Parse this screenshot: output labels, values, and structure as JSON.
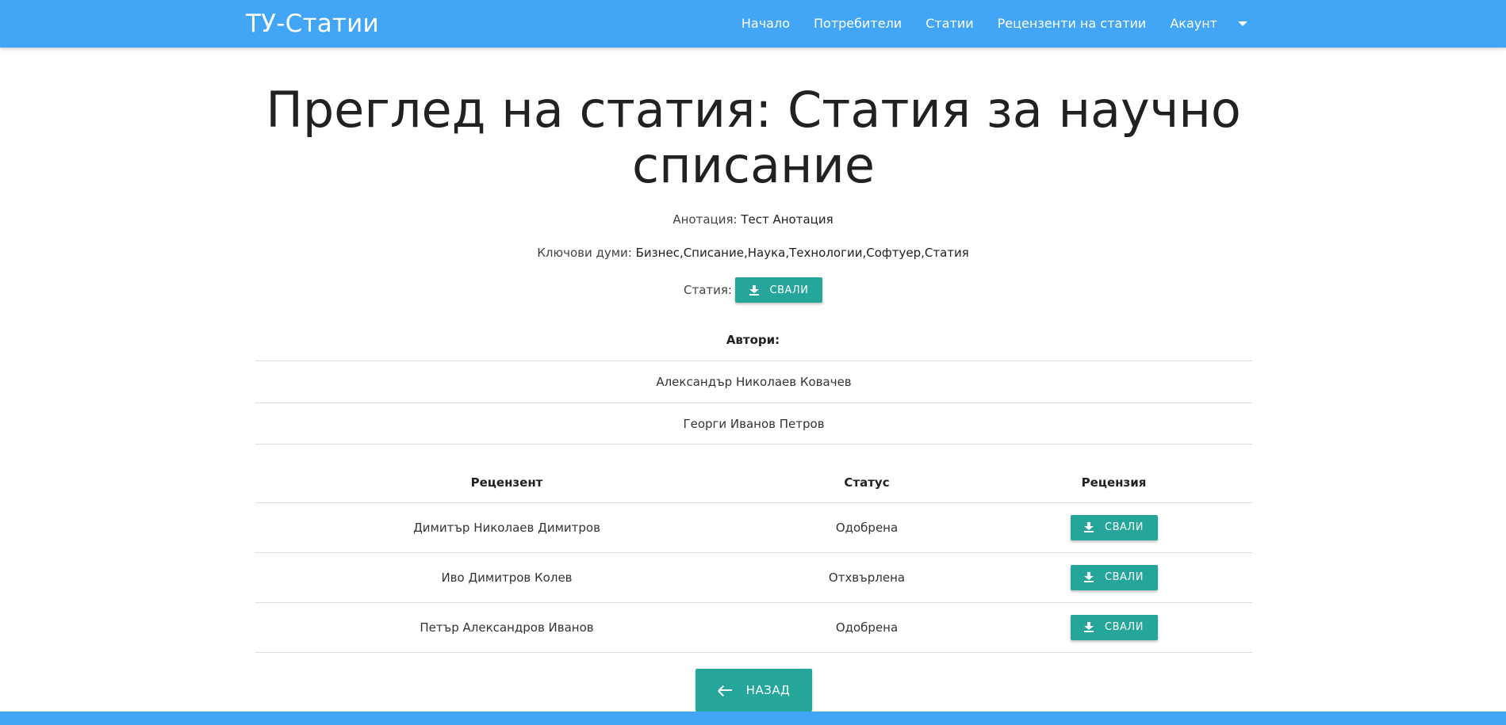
{
  "navbar": {
    "brand": "ТУ-Статии",
    "links": [
      "Начало",
      "Потребители",
      "Статии",
      "Рецензенти на статии",
      "Акаунт"
    ]
  },
  "page": {
    "title": "Преглед на статия: Статия за научно списание",
    "annotation_label": "Анотация:",
    "annotation_value": "Тест Анотация",
    "keywords_label": "Ключови думи:",
    "keywords_value": "Бизнес,Списание,Наука,Технологии,Софтуер,Статия",
    "article_label": "Статия:",
    "download_label": "СВАЛИ",
    "authors_title": "Автори:",
    "authors": [
      "Александър Николаев Ковачев",
      "Георги Иванов Петров"
    ],
    "back_label": "НАЗАД"
  },
  "reviews": {
    "headers": [
      "Рецензент",
      "Статус",
      "Рецензия"
    ],
    "rows": [
      {
        "reviewer": "Димитър Николаев Димитров",
        "status": "Одобрена",
        "action": "СВАЛИ"
      },
      {
        "reviewer": "Иво Димитров Колев",
        "status": "Отхвърлена",
        "action": "СВАЛИ"
      },
      {
        "reviewer": "Петър Александров Иванов",
        "status": "Одобрена",
        "action": "СВАЛИ"
      }
    ]
  },
  "colors": {
    "navbar": "#42a5f5",
    "button": "#26a69a"
  },
  "icons": [
    "download-icon",
    "arrow-left-icon",
    "caret-down-icon"
  ]
}
